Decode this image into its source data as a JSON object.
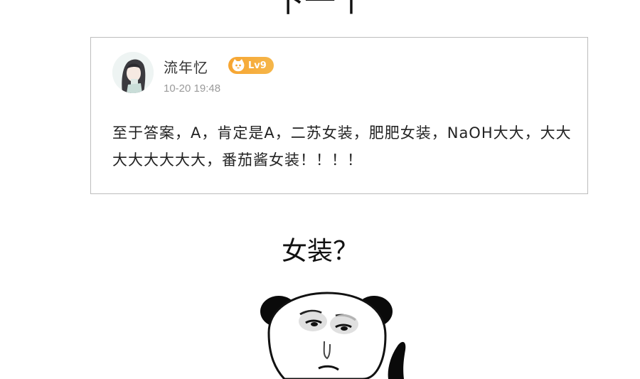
{
  "top_heading": "下一个",
  "comment": {
    "user_name": "流年忆",
    "level_badge": "Lv9",
    "timestamp": "10-20 19:48",
    "text": "至于答案，A，肯定是A，二苏女装，肥肥女装，NaOH大大，大大大大大大大大，番茄酱女装！！！！"
  },
  "middle_heading": "女装？",
  "icons": {
    "avatar": "anime-girl-avatar",
    "badge": "cat-icon",
    "meme": "panda-meme"
  },
  "colors": {
    "badge": "#f7a531",
    "timestamp": "#9a9a9a",
    "card_border": "#bdbdbd"
  }
}
